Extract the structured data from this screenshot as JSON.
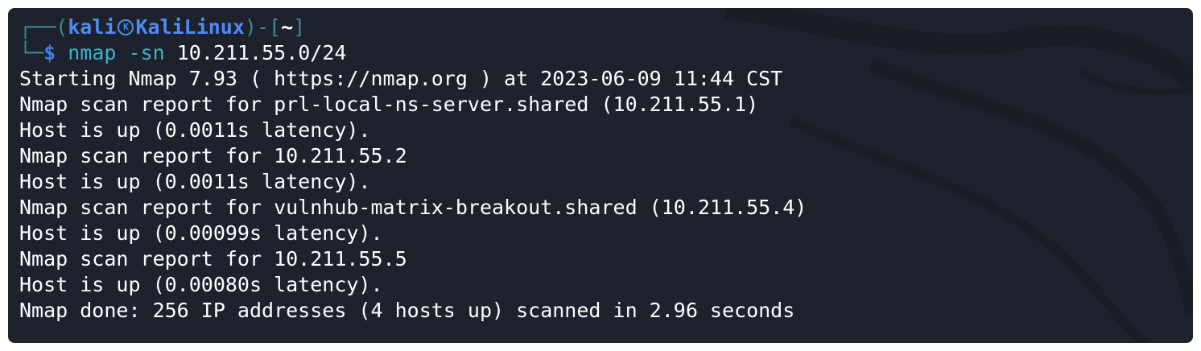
{
  "prompt": {
    "frame_top_left": "┌──(",
    "user": "kali",
    "host": "KaliLinux",
    "frame_mid": ")-[",
    "cwd": "~",
    "frame_close": "]",
    "frame_bottom_left": "└─",
    "dollar": "$",
    "command": "nmap",
    "flag": "-sn",
    "target": "10.211.55.0/24"
  },
  "output_lines": [
    "Starting Nmap 7.93 ( https://nmap.org ) at 2023-06-09 11:44 CST",
    "Nmap scan report for prl-local-ns-server.shared (10.211.55.1)",
    "Host is up (0.0011s latency).",
    "Nmap scan report for 10.211.55.2",
    "Host is up (0.0011s latency).",
    "Nmap scan report for vulnhub-matrix-breakout.shared (10.211.55.4)",
    "Host is up (0.00099s latency).",
    "Nmap scan report for 10.211.55.5",
    "Host is up (0.00080s latency).",
    "Nmap done: 256 IP addresses (4 hosts up) scanned in 2.96 seconds"
  ],
  "colors": {
    "background": "#1e222c",
    "frame": "#3a8a97",
    "user_host": "#4f8bf5",
    "command": "#3eb0c8",
    "text": "#ffffff"
  },
  "icons": {
    "kali_logo": "kali-dragon-icon"
  }
}
